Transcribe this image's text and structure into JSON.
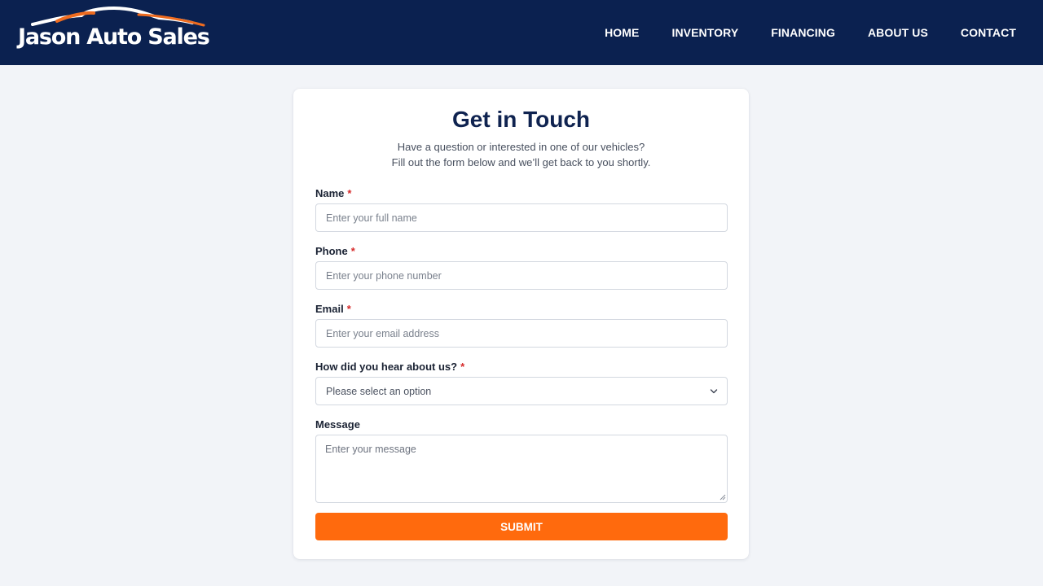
{
  "brand": {
    "name": "Jason Auto Sales",
    "logo_icon": "car-silhouette-icon"
  },
  "nav": {
    "items": [
      "HOME",
      "INVENTORY",
      "FINANCING",
      "ABOUT US",
      "CONTACT"
    ]
  },
  "form": {
    "title": "Get in Touch",
    "subtitle_line1": "Have a question or interested in one of our vehicles?",
    "subtitle_line2": "Fill out the form below and we’ll get back to you shortly.",
    "required_marker": "*",
    "name": {
      "label": "Name",
      "placeholder": "Enter your full name",
      "value": ""
    },
    "phone": {
      "label": "Phone",
      "placeholder": "Enter your phone number",
      "value": ""
    },
    "email": {
      "label": "Email",
      "placeholder": "Enter your email address",
      "value": ""
    },
    "source": {
      "label": "How did you hear about us?",
      "selected": "Please select an option"
    },
    "message": {
      "label": "Message",
      "placeholder": "Enter your message",
      "value": ""
    },
    "submit_label": "SUBMIT"
  },
  "colors": {
    "header_bg": "#0b2150",
    "accent": "#ff6a0d",
    "page_bg": "#f2f4f8",
    "title": "#0f2350",
    "required": "#d62a2a"
  }
}
